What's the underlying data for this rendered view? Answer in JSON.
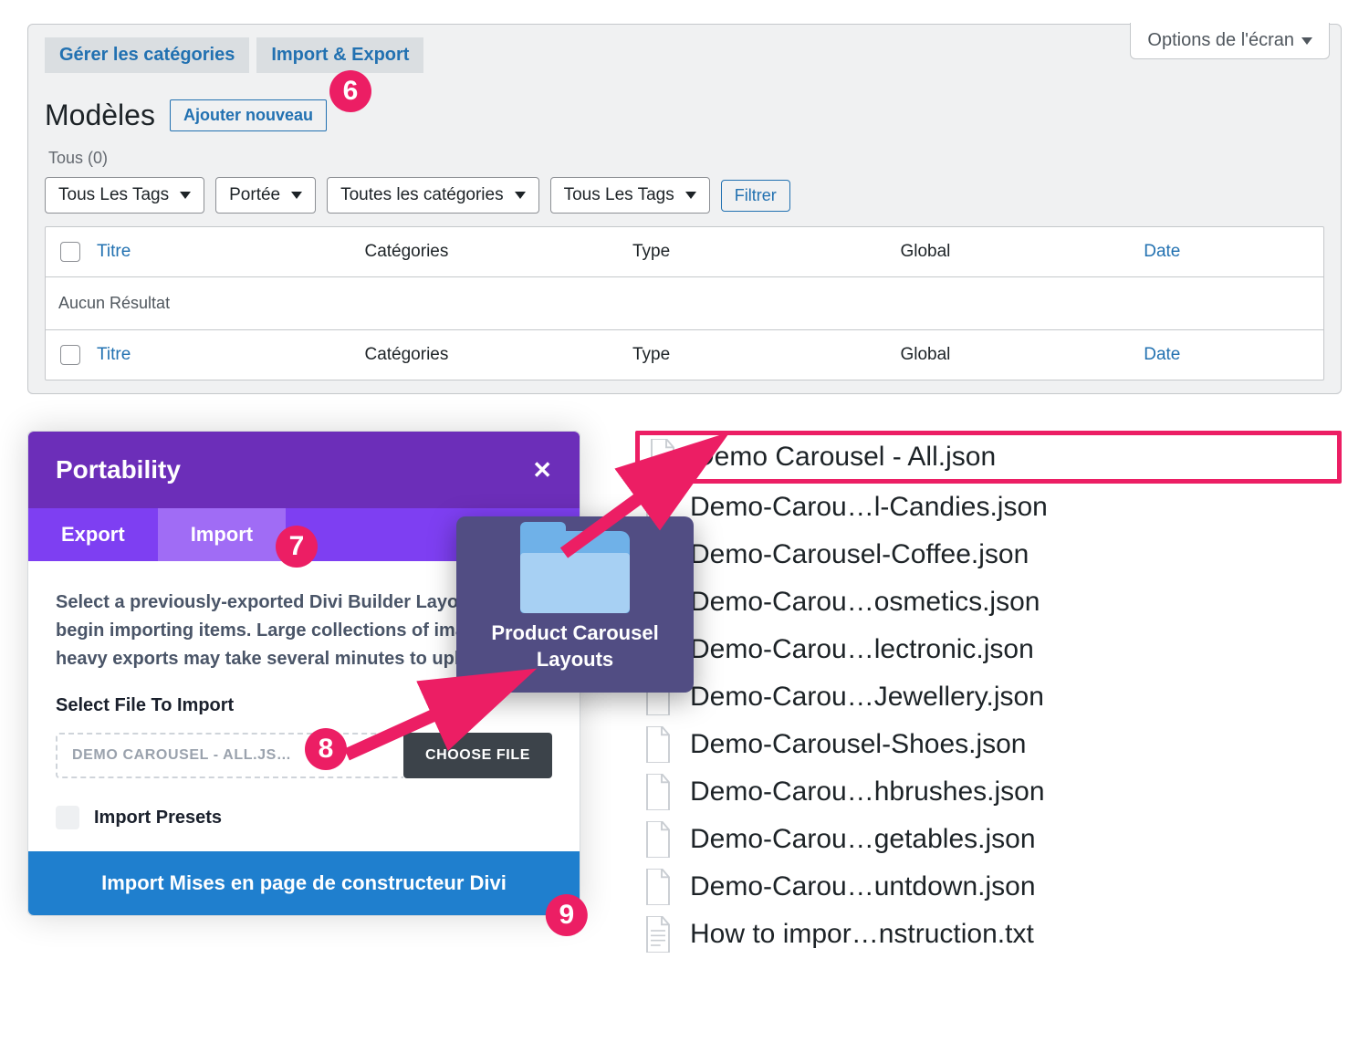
{
  "screen_options": "Options de l'écran",
  "top_tabs": {
    "manage": "Gérer les catégories",
    "importexport": "Import & Export"
  },
  "page_title": "Modèles",
  "add_new": "Ajouter nouveau",
  "all_label": "Tous",
  "all_count": "(0)",
  "selects": {
    "tags1": "Tous Les Tags",
    "scope": "Portée",
    "cats": "Toutes les catégories",
    "tags2": "Tous Les Tags"
  },
  "filter": "Filtrer",
  "columns": {
    "title": "Titre",
    "categories": "Catégories",
    "type": "Type",
    "global": "Global",
    "date": "Date"
  },
  "no_result": "Aucun Résultat",
  "badges": {
    "six": "6",
    "seven": "7",
    "eight": "8",
    "nine": "9"
  },
  "divi": {
    "header": "Portability",
    "tab_export": "Export",
    "tab_import": "Import",
    "desc": "Select a previously-exported Divi Builder Layouts file to begin importing items. Large collections of images or heavy exports may take several minutes to upload.",
    "select_label": "Select File To Import",
    "filename": "DEMO CAROUSEL - ALL.JS…",
    "choose": "CHOOSE FILE",
    "import_presets": "Import Presets",
    "import_btn": "Import Mises en page de constructeur Divi"
  },
  "folder_label": "Product Carousel Layouts",
  "files": [
    "Demo Carousel - All.json",
    "Demo-Carou…l-Candies.json",
    "Demo-Carousel-Coffee.json",
    "Demo-Carou…osmetics.json",
    "Demo-Carou…lectronic.json",
    "Demo-Carou…Jewellery.json",
    "Demo-Carousel-Shoes.json",
    "Demo-Carou…hbrushes.json",
    "Demo-Carou…getables.json",
    "Demo-Carou…untdown.json",
    "How to impor…nstruction.txt"
  ]
}
